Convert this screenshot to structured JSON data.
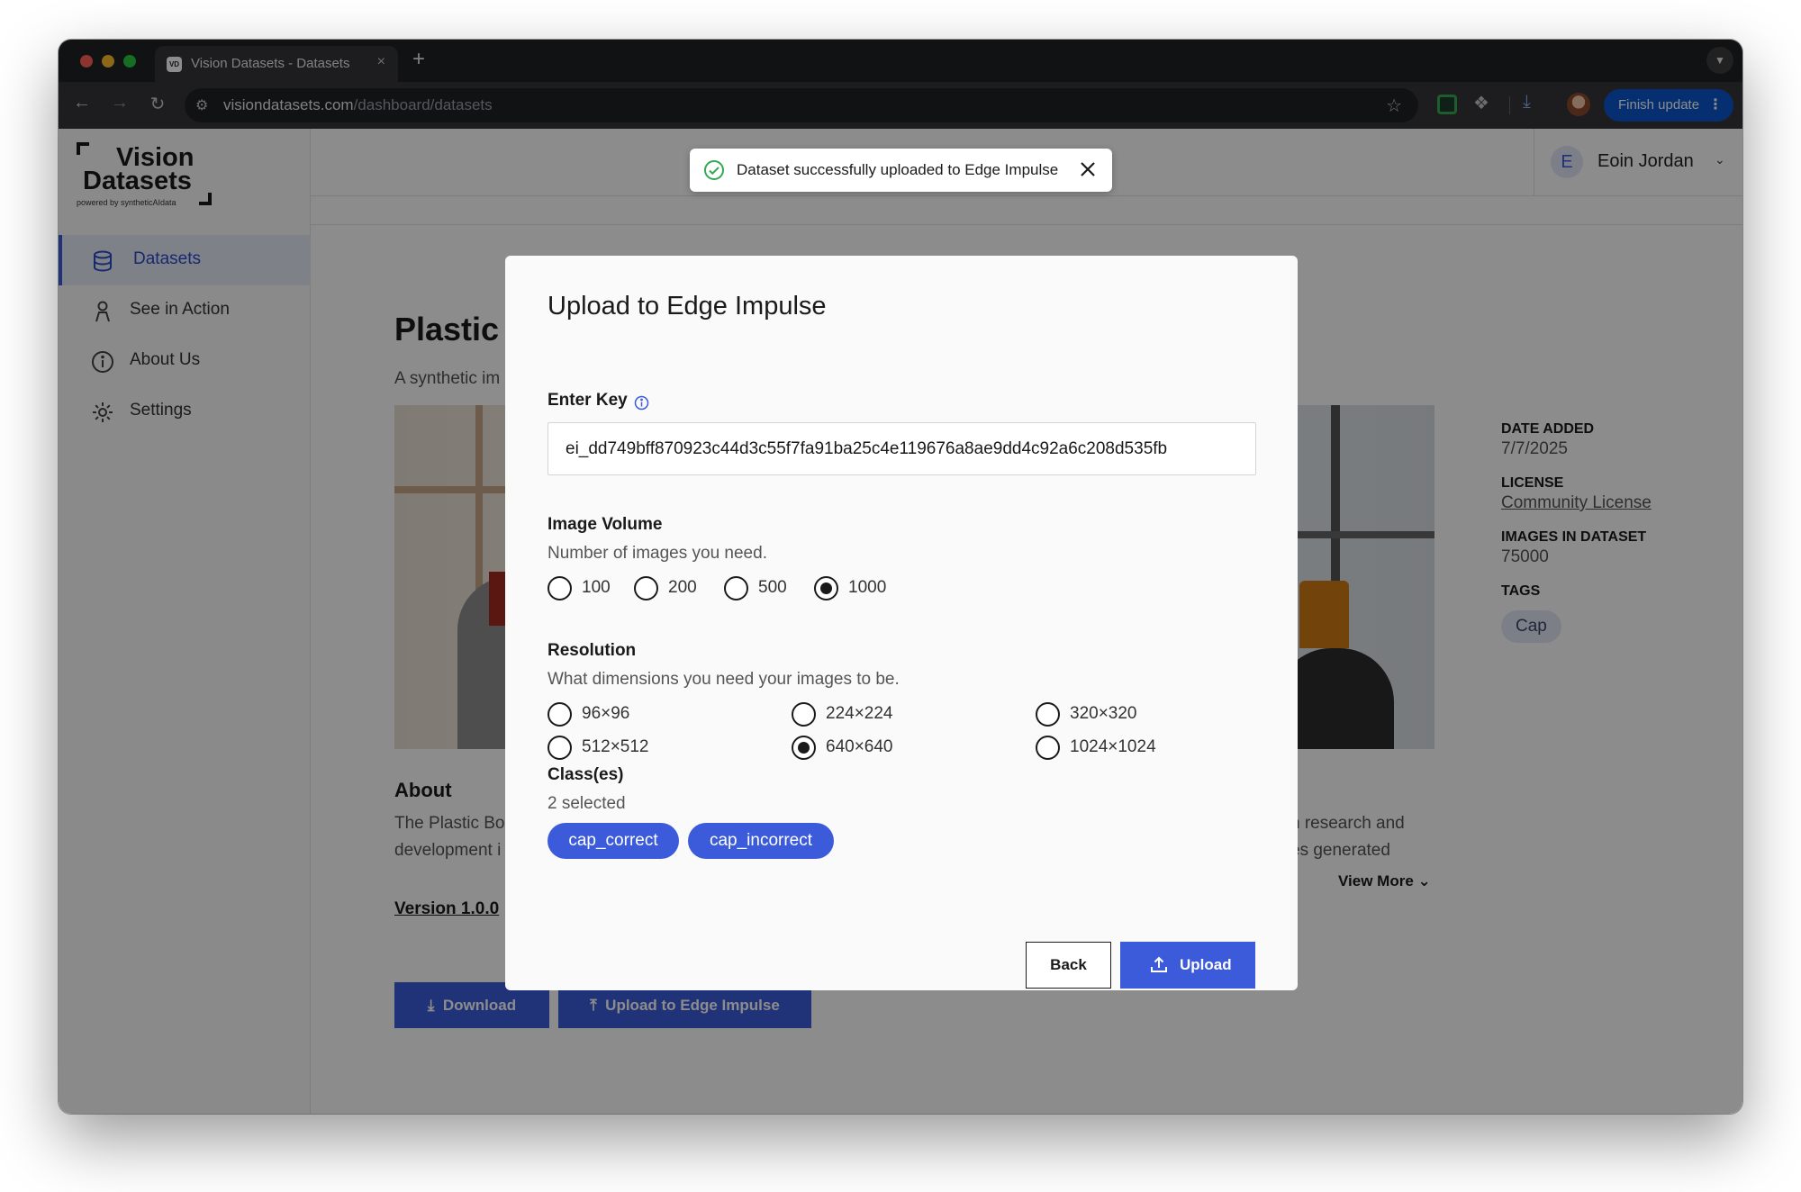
{
  "browser": {
    "tab_title": "Vision Datasets - Datasets",
    "tab_favicon_text": "VD",
    "tab_close": "×",
    "new_tab": "+",
    "url_host": "visiondatasets.com",
    "url_path": "/dashboard/datasets",
    "finish_update_label": "Finish update"
  },
  "sidebar": {
    "logo_line1": "Vision",
    "logo_line2": "Datasets",
    "logo_tagline": "powered by syntheticAIdata",
    "items": [
      {
        "label": "Datasets",
        "icon": "database-icon",
        "active": true
      },
      {
        "label": "See in Action",
        "icon": "person-icon",
        "active": false
      },
      {
        "label": "About Us",
        "icon": "info-icon",
        "active": false
      },
      {
        "label": "Settings",
        "icon": "gear-icon",
        "active": false
      }
    ]
  },
  "header": {
    "user_initial": "E",
    "user_name": "Eoin Jordan"
  },
  "toast": {
    "message": "Dataset successfully uploaded to Edge Impulse"
  },
  "dataset": {
    "title_visible": "Plastic B",
    "subtitle_visible": "A synthetic im",
    "about_title": "About",
    "about_left_lines": [
      "The Plastic Bo",
      "development i"
    ],
    "about_right_lines": [
      "n research and",
      "es generated"
    ],
    "view_more": "View More",
    "version": "Version 1.0.0",
    "download_label": "Download",
    "upload_label": "Upload to Edge Impulse"
  },
  "meta": {
    "date_added_label": "DATE ADDED",
    "date_added": "7/7/2025",
    "license_label": "LICENSE",
    "license": "Community License",
    "images_label": "IMAGES IN DATASET",
    "images": "75000",
    "tags_label": "TAGS",
    "tags": [
      "Cap"
    ]
  },
  "modal": {
    "title": "Upload to Edge Impulse",
    "key_label": "Enter Key",
    "key_value": "ei_dd749bff870923c44d3c55f7fa91ba25c4e119676a8ae9dd4c92a6c208d535fb",
    "volume_label": "Image Volume",
    "volume_help": "Number of images you need.",
    "volume_options": [
      "100",
      "200",
      "500",
      "1000"
    ],
    "volume_selected": "1000",
    "resolution_label": "Resolution",
    "resolution_help": "What dimensions you need your images to be.",
    "resolution_options": [
      "96×96",
      "224×224",
      "320×320",
      "512×512",
      "640×640",
      "1024×1024"
    ],
    "resolution_selected": "640×640",
    "classes_label": "Class(es)",
    "classes_count": "2 selected",
    "classes": [
      "cap_correct",
      "cap_incorrect"
    ],
    "back_label": "Back",
    "upload_label": "Upload"
  },
  "colors": {
    "accent": "#3b5bdb",
    "success": "#34a853",
    "overlay": "rgba(0,0,0,0.45)"
  }
}
